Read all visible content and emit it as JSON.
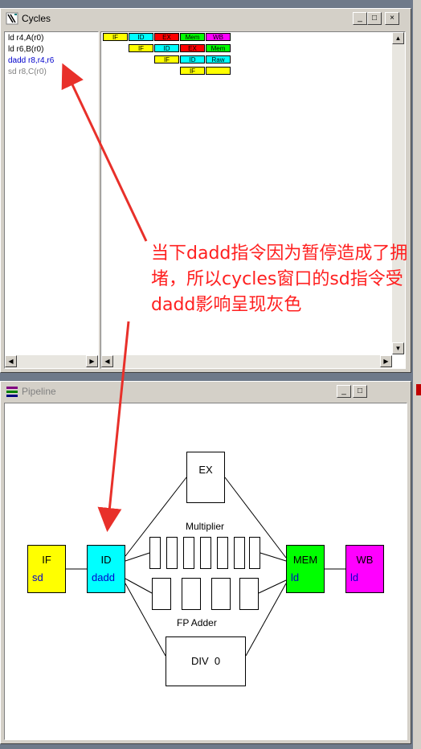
{
  "cycles_window": {
    "title": "Cycles",
    "instructions": [
      {
        "text": "ld r4,A(r0)",
        "color": "#000000"
      },
      {
        "text": "ld r6,B(r0)",
        "color": "#000000"
      },
      {
        "text": "dadd r8,r4,r6",
        "color": "#0000cc"
      },
      {
        "text": "sd r8,C(r0)",
        "color": "#808080"
      }
    ],
    "stage_rows": [
      [
        {
          "label": "IF",
          "color": "#ffff00"
        },
        {
          "label": "ID",
          "color": "#00ffff"
        },
        {
          "label": "EX",
          "color": "#ff0000"
        },
        {
          "label": "Mem",
          "color": "#00ff00"
        },
        {
          "label": "WB",
          "color": "#ff00ff"
        }
      ],
      [
        {
          "label": "IF",
          "color": "#ffff00"
        },
        {
          "label": "ID",
          "color": "#00ffff"
        },
        {
          "label": "EX",
          "color": "#ff0000"
        },
        {
          "label": "Mem",
          "color": "#00ff00"
        }
      ],
      [
        {
          "label": "IF",
          "color": "#ffff00"
        },
        {
          "label": "ID",
          "color": "#00ffff"
        },
        {
          "label": "Raw",
          "color": "#00ffff"
        }
      ],
      [
        {
          "label": "IF",
          "color": "#ffff00"
        },
        {
          "label": "",
          "color": "#ffff00"
        }
      ]
    ],
    "buttons": {
      "minimize": "_",
      "maximize": "□",
      "close": "×"
    }
  },
  "pipeline_window": {
    "title": "Pipeline",
    "buttons": {
      "minimize": "_",
      "maximize": "□"
    },
    "stages": {
      "if": {
        "name": "IF",
        "instr": "sd",
        "color": "#ffff00"
      },
      "id": {
        "name": "ID",
        "instr": "dadd",
        "color": "#00ffff"
      },
      "mem": {
        "name": "MEM",
        "instr": "ld",
        "color": "#00ff00"
      },
      "wb": {
        "name": "WB",
        "instr": "ld",
        "color": "#ff00ff"
      }
    },
    "ex_label": "EX",
    "multiplier_label": "Multiplier",
    "fp_adder_label": "FP Adder",
    "div_label": "DIV  0"
  },
  "annotation": {
    "text": "当下dadd指令因为暂停造成了拥堵，所以cycles窗口的sd指令受dadd影响呈现灰色",
    "color": "#ff2020"
  }
}
